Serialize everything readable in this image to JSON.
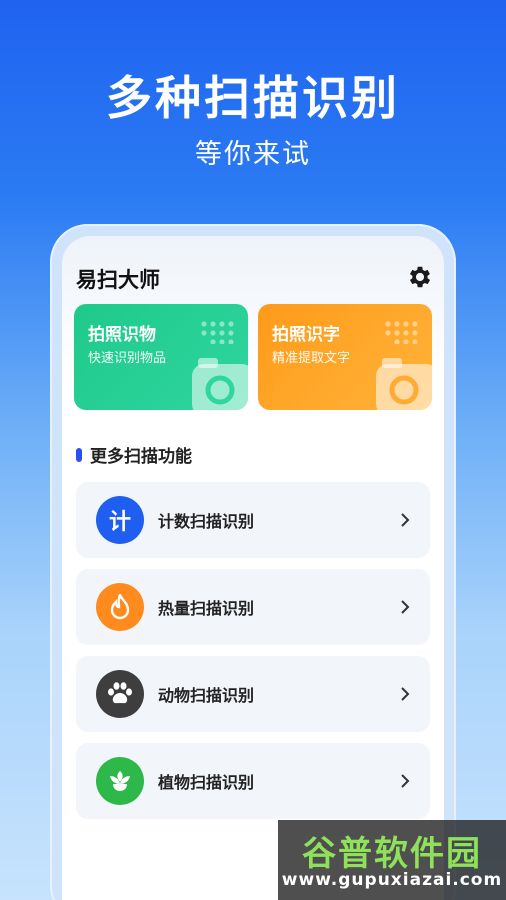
{
  "hero": {
    "title": "多种扫描识别",
    "subtitle": "等你来试"
  },
  "app": {
    "title": "易扫大师",
    "settings_icon": "gear-icon"
  },
  "cards": [
    {
      "title": "拍照识物",
      "subtitle": "快速识别物品",
      "color": "#22cc8f",
      "icon": "camera-icon"
    },
    {
      "title": "拍照识字",
      "subtitle": "精准提取文字",
      "color": "#ffa425",
      "icon": "camera-icon"
    }
  ],
  "section": {
    "title": "更多扫描功能"
  },
  "features": [
    {
      "label": "计数扫描识别",
      "icon_text": "计",
      "icon": "count-icon",
      "color": "#1e5ef0"
    },
    {
      "label": "热量扫描识别",
      "icon": "flame-icon",
      "color": "#ff8a1e"
    },
    {
      "label": "动物扫描识别",
      "icon": "paw-icon",
      "color": "#3e3e3e"
    },
    {
      "label": "植物扫描识别",
      "icon": "flower-icon",
      "color": "#2eb84a"
    }
  ],
  "watermark": {
    "brand": "谷普软件园",
    "url": "www.gupuxiazai.com"
  }
}
